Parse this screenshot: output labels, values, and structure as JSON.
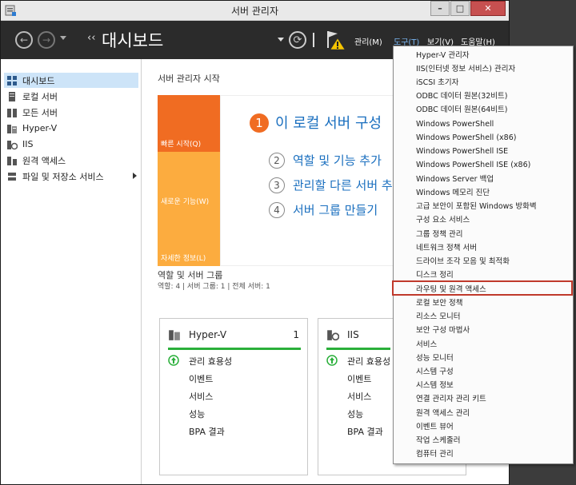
{
  "window": {
    "title": "서버 관리자"
  },
  "header": {
    "breadcrumb_title": "대시보드",
    "menus": [
      "관리(M)",
      "도구(T)",
      "보기(V)",
      "도움말(H)"
    ]
  },
  "sidebar": {
    "items": [
      {
        "label": "대시보드",
        "icon": "dashboard-icon",
        "selected": true
      },
      {
        "label": "로컬 서버",
        "icon": "server-icon"
      },
      {
        "label": "모든 서버",
        "icon": "servers-icon"
      },
      {
        "label": "Hyper-V",
        "icon": "hyperv-icon"
      },
      {
        "label": "IIS",
        "icon": "iis-icon"
      },
      {
        "label": "원격 액세스",
        "icon": "remote-access-icon"
      },
      {
        "label": "파일 및 저장소 서비스",
        "icon": "storage-icon",
        "has_children": true
      }
    ]
  },
  "main": {
    "welcome_title": "서버 관리자 시작",
    "tiles": [
      "빠른 시작(Q)",
      "새로운 기능(W)",
      "자세한 정보(L)"
    ],
    "quick_start": [
      {
        "num": "1",
        "label": "이 로컬 서버 구성"
      },
      {
        "num": "2",
        "label": "역할 및 기능 추가"
      },
      {
        "num": "3",
        "label": "관리할 다른 서버 추"
      },
      {
        "num": "4",
        "label": "서버 그룹 만들기"
      }
    ],
    "roles_title": "역할 및 서버 그룹",
    "roles_summary": "역할: 4   |   서버 그룹: 1   |   전체 서버: 1",
    "cards": [
      {
        "name": "Hyper-V",
        "count": "1",
        "rows": [
          "관리 효용성",
          "이벤트",
          "서비스",
          "성능",
          "BPA 결과"
        ]
      },
      {
        "name": "IIS",
        "count": "",
        "rows": [
          "관리 효용성",
          "이벤트",
          "서비스",
          "성능",
          "BPA 결과"
        ]
      }
    ]
  },
  "tools_menu": {
    "items": [
      "Hyper-V 관리자",
      "IIS(인터넷 정보 서비스) 관리자",
      "iSCSI 초기자",
      "ODBC 데이터 원본(32비트)",
      "ODBC 데이터 원본(64비트)",
      "Windows PowerShell",
      "Windows PowerShell (x86)",
      "Windows PowerShell ISE",
      "Windows PowerShell ISE (x86)",
      "Windows Server 백업",
      "Windows 메모리 진단",
      "고급 보안이 포함된 Windows 방화벽",
      "구성 요소 서비스",
      "그룹 정책 관리",
      "네트워크 정책 서버",
      "드라이브 조각 모음 및 최적화",
      "디스크 정리",
      "라우팅 및 원격 액세스",
      "로컬 보안 정책",
      "리소스 모니터",
      "보안 구성 마법사",
      "서비스",
      "성능 모니터",
      "시스템 구성",
      "시스템 정보",
      "연결 관리자 관리 키트",
      "원격 액세스 관리",
      "이벤트 뷰어",
      "작업 스케줄러",
      "컴퓨터 관리"
    ],
    "highlighted_index": 17
  },
  "colors": {
    "accent": "#f06c22",
    "tile": "#fcac3f",
    "link": "#1a6fbf",
    "header": "#2b2b2b",
    "highlight": "#c0392b"
  }
}
